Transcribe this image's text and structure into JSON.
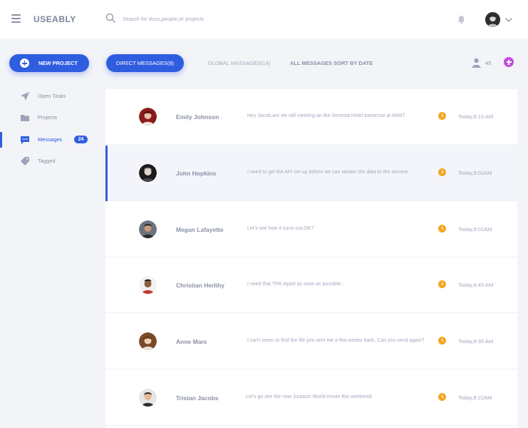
{
  "header": {
    "logo": "USEABLY",
    "search_placeholder": "Search for docs,people,or projects"
  },
  "actions": {
    "new_project": "NEW PROJECT",
    "tabs": [
      {
        "label": "DIRECT MESSAGES(8)",
        "active": true
      },
      {
        "label": "GLOBAL MASSAGES(14)",
        "active": false
      },
      {
        "label": "ALL MESSAGES SORT BY DATE",
        "active": false
      }
    ],
    "people_count": "45"
  },
  "sidebar": {
    "items": [
      {
        "label": "Open Tasks",
        "icon": "send-icon"
      },
      {
        "label": "Projects",
        "icon": "folder-icon"
      },
      {
        "label": "Messages",
        "icon": "chat-icon",
        "badge": "24",
        "active": true
      },
      {
        "label": "Tagged",
        "icon": "tag-icon"
      }
    ]
  },
  "messages": [
    {
      "name": "Emily Johnson",
      "text": "Hey Jacob,are we still meeting an the Sonesta Hotel tomorrow at 9AM?",
      "time": "Today,9:15 AM"
    },
    {
      "name": "John Hopkins",
      "text": "I need to get the API set up before we can stream the data to the servers",
      "time": "Today,9:02AM",
      "selected": true
    },
    {
      "name": "Megan Lafayette",
      "text": "Let's see how it turns out,OK?",
      "time": "Today,9:01AM"
    },
    {
      "name": "Christian Herlihy",
      "text": "I need that TPA report as soon as possible...",
      "time": "Today,8:45 AM"
    },
    {
      "name": "Anne Marx",
      "text": "I can't seem to find the file you sent me a few weeks back. Can you send again?",
      "time": "Today,8:35 AM"
    },
    {
      "name": "Tristan Jacobs",
      "text": "Let's go see the new Jurassic World movie this weekend!",
      "time": "Today,8:22AM"
    }
  ],
  "colors": {
    "accent": "#2f5de0",
    "add": "#c64bde",
    "clock": "#f5a623"
  }
}
